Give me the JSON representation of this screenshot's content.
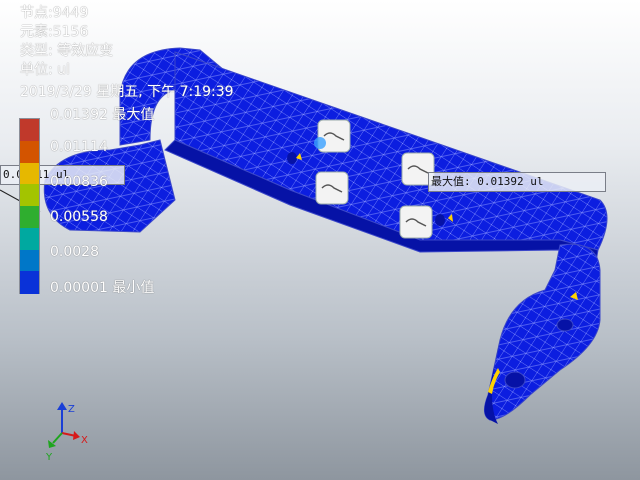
{
  "model_info": {
    "node_count": "节点:9449",
    "element_count": "元素:5156",
    "result_type": "类型: 等效应变",
    "unit": "单位: ul",
    "timestamp": "2019/3/29 星期五, 下午 7:19:39"
  },
  "legend": {
    "ticks": [
      "0.01392 最大值",
      "0.01114",
      "0.00836",
      "0.00558",
      "0.0028",
      "0.00001 最小值"
    ],
    "colors": [
      "#c0392b",
      "#d35400",
      "#e6b800",
      "#a3c400",
      "#2fae2f",
      "#00a9a0",
      "#0077c8",
      "#0a32d8"
    ]
  },
  "probes": {
    "max_probe": "最大值: 0.01392 ul",
    "left_probe": "0.01111 ul"
  },
  "triad": {
    "x": "X",
    "y": "Y",
    "z": "Z"
  },
  "colors": {
    "mesh_fill": "#0c1ee0",
    "mesh_dark": "#0612a6",
    "mesh_line": "#9fa8ff",
    "hotspot": "#ffd200"
  }
}
